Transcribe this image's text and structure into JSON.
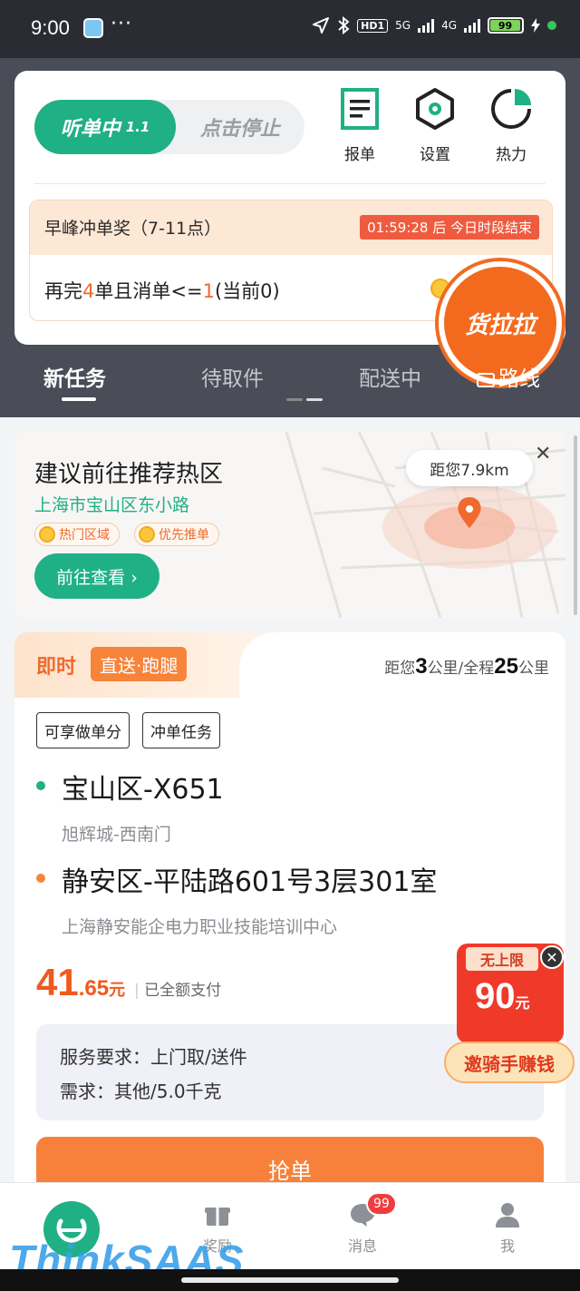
{
  "status_bar": {
    "time": "9:00",
    "more": "···",
    "hd_label": "HD1",
    "net_5g": "5G",
    "net_4g": "4G",
    "battery": "99"
  },
  "top_card": {
    "listening_label": "听单中",
    "listening_version": "1.1",
    "stop_label": "点击停止",
    "tools": [
      {
        "label": "报单",
        "icon": "document-icon"
      },
      {
        "label": "设置",
        "icon": "hexagon-settings-icon"
      },
      {
        "label": "热力",
        "icon": "pie-chart-icon"
      }
    ],
    "bonus": {
      "title": "早峰冲单奖（7-11点）",
      "timer": "01:59:28 后 今日时段结束",
      "body_prefix": "再完",
      "body_count": "4",
      "body_mid": "单且消单<=",
      "body_limit": "1",
      "body_suffix": "(当前0)"
    },
    "brand_badge": "货拉拉"
  },
  "tabs": [
    {
      "label": "新任务",
      "active": true
    },
    {
      "label": "待取件",
      "active": false
    },
    {
      "label": "配送中",
      "active": false
    },
    {
      "label": "路线",
      "active": false
    }
  ],
  "hotzone": {
    "title": "建议前往推荐热区",
    "address": "上海市宝山区东小路",
    "tags": [
      "热门区域",
      "优先推单"
    ],
    "go_button": "前往查看 ›",
    "distance": "距您7.9km",
    "close": "✕"
  },
  "order": {
    "mode": "即时",
    "type": "直送·跑腿",
    "distance_prefix": "距您",
    "distance_km": "3",
    "distance_mid": "公里/全程",
    "total_km": "25",
    "distance_suffix": "公里",
    "chips": [
      "可享做单分",
      "冲单任务"
    ],
    "pickup": {
      "title": "宝山区-X651",
      "sub": "旭辉城-西南门"
    },
    "dropoff": {
      "title": "静安区-平陆路601号3层301室",
      "sub": "上海静安能企电力职业技能培训中心"
    },
    "price_int": "41",
    "price_dec": ".65",
    "price_unit": "元",
    "paid_label": "已全额支付",
    "service_req": "服务要求：上门取/送件",
    "need": "需求：其他/5.0千克",
    "grab_button": "抢单"
  },
  "promo": {
    "limit": "无上限",
    "amount": "90",
    "unit": "元",
    "cta": "邀骑手赚钱"
  },
  "bottom_nav": [
    {
      "label": "",
      "icon": "home-logo-icon"
    },
    {
      "label": "奖励",
      "icon": "gift-icon"
    },
    {
      "label": "消息",
      "icon": "message-icon",
      "badge": "99"
    },
    {
      "label": "我",
      "icon": "user-icon"
    }
  ],
  "watermark": "ThinkSAAS",
  "colors": {
    "brand_green": "#1fb086",
    "accent_orange": "#f06a2e",
    "header_dark": "#4a4d58"
  }
}
